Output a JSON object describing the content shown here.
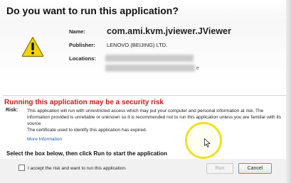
{
  "dialog": {
    "title": "Do you want to run this application?"
  },
  "app_info": {
    "name_label": "Name:",
    "name_value": "com.ami.kvm.jviewer.JViewer",
    "publisher_label": "Publisher:",
    "publisher_value": "LENOVO (BEIJING) LTD.",
    "locations_label": "Locations:",
    "locations_tail": "e"
  },
  "risk": {
    "heading": "Running this application may be a security risk",
    "label": "Risk:",
    "text": "This application will run with unrestricted access which may put your computer and personal information at risk. The information provided is unreliable or unknown so it is recommended not to run this application unless you are familiar with its source",
    "certificate_text": "The certificate used to identify this application has expired.",
    "more_info": "More Information"
  },
  "footer": {
    "instruction": "Select the box below, then click Run to start the application",
    "accept_label": "I accept the risk and want to run this application.",
    "accept_checked": false,
    "run_label": "Run",
    "cancel_label": "Cancel"
  },
  "icons": {
    "warning": "warning-icon",
    "cursor": "mouse-cursor-icon"
  },
  "colors": {
    "risk_heading": "#cc1a1a",
    "link": "#1f5fa8",
    "warning_fill": "#f5d20a",
    "cursor_highlight": "#f0e024"
  }
}
